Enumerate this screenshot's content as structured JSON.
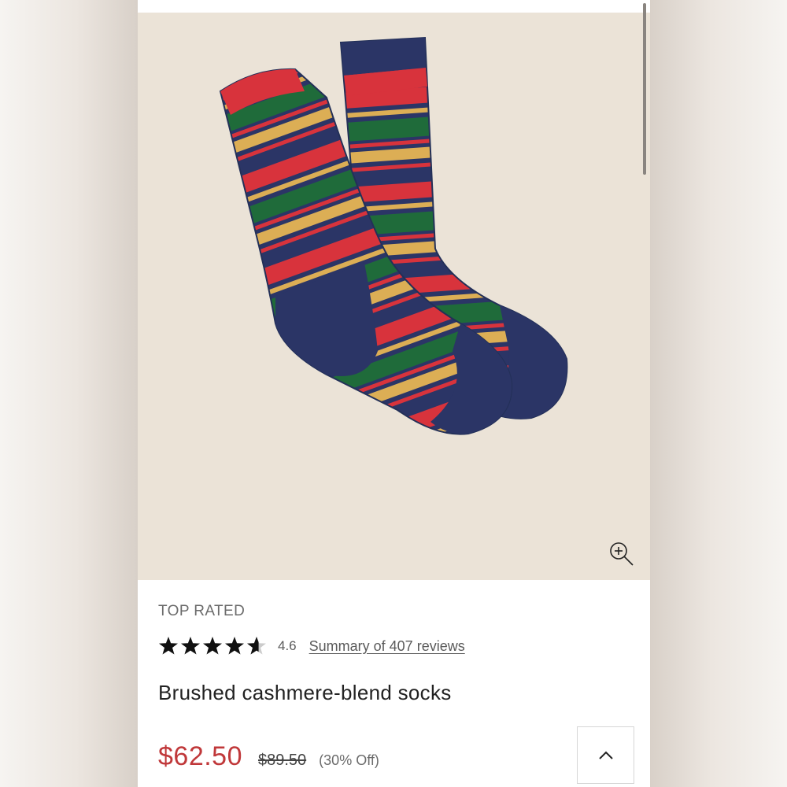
{
  "product": {
    "badge": "TOP RATED",
    "rating": 4.6,
    "rating_text": "4.6",
    "reviews_link": "Summary of 407 reviews",
    "title": "Brushed cashmere-blend socks",
    "sale_price": "$62.50",
    "original_price": "$89.50",
    "discount": "(30% Off)"
  },
  "icons": {
    "zoom": "zoom-in-icon",
    "star": "star-icon",
    "back_to_top": "chevron-up-icon"
  },
  "colors": {
    "image_background": "#ebe3d7",
    "sale_price": "#c0383a",
    "sock_navy": "#2b3566",
    "sock_red": "#d8333c",
    "sock_green": "#1f6b3a",
    "sock_yellow": "#dcae55"
  }
}
